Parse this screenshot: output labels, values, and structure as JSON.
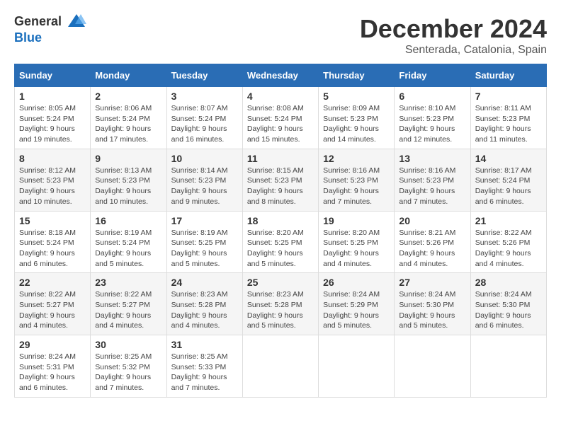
{
  "logo": {
    "general": "General",
    "blue": "Blue"
  },
  "title": "December 2024",
  "subtitle": "Senterada, Catalonia, Spain",
  "days_header": [
    "Sunday",
    "Monday",
    "Tuesday",
    "Wednesday",
    "Thursday",
    "Friday",
    "Saturday"
  ],
  "weeks": [
    [
      {
        "day": "1",
        "sunrise": "8:05 AM",
        "sunset": "5:24 PM",
        "daylight": "9 hours and 19 minutes."
      },
      {
        "day": "2",
        "sunrise": "8:06 AM",
        "sunset": "5:24 PM",
        "daylight": "9 hours and 17 minutes."
      },
      {
        "day": "3",
        "sunrise": "8:07 AM",
        "sunset": "5:24 PM",
        "daylight": "9 hours and 16 minutes."
      },
      {
        "day": "4",
        "sunrise": "8:08 AM",
        "sunset": "5:24 PM",
        "daylight": "9 hours and 15 minutes."
      },
      {
        "day": "5",
        "sunrise": "8:09 AM",
        "sunset": "5:23 PM",
        "daylight": "9 hours and 14 minutes."
      },
      {
        "day": "6",
        "sunrise": "8:10 AM",
        "sunset": "5:23 PM",
        "daylight": "9 hours and 12 minutes."
      },
      {
        "day": "7",
        "sunrise": "8:11 AM",
        "sunset": "5:23 PM",
        "daylight": "9 hours and 11 minutes."
      }
    ],
    [
      {
        "day": "8",
        "sunrise": "8:12 AM",
        "sunset": "5:23 PM",
        "daylight": "9 hours and 10 minutes."
      },
      {
        "day": "9",
        "sunrise": "8:13 AM",
        "sunset": "5:23 PM",
        "daylight": "9 hours and 10 minutes."
      },
      {
        "day": "10",
        "sunrise": "8:14 AM",
        "sunset": "5:23 PM",
        "daylight": "9 hours and 9 minutes."
      },
      {
        "day": "11",
        "sunrise": "8:15 AM",
        "sunset": "5:23 PM",
        "daylight": "9 hours and 8 minutes."
      },
      {
        "day": "12",
        "sunrise": "8:16 AM",
        "sunset": "5:23 PM",
        "daylight": "9 hours and 7 minutes."
      },
      {
        "day": "13",
        "sunrise": "8:16 AM",
        "sunset": "5:23 PM",
        "daylight": "9 hours and 7 minutes."
      },
      {
        "day": "14",
        "sunrise": "8:17 AM",
        "sunset": "5:24 PM",
        "daylight": "9 hours and 6 minutes."
      }
    ],
    [
      {
        "day": "15",
        "sunrise": "8:18 AM",
        "sunset": "5:24 PM",
        "daylight": "9 hours and 6 minutes."
      },
      {
        "day": "16",
        "sunrise": "8:19 AM",
        "sunset": "5:24 PM",
        "daylight": "9 hours and 5 minutes."
      },
      {
        "day": "17",
        "sunrise": "8:19 AM",
        "sunset": "5:25 PM",
        "daylight": "9 hours and 5 minutes."
      },
      {
        "day": "18",
        "sunrise": "8:20 AM",
        "sunset": "5:25 PM",
        "daylight": "9 hours and 5 minutes."
      },
      {
        "day": "19",
        "sunrise": "8:20 AM",
        "sunset": "5:25 PM",
        "daylight": "9 hours and 4 minutes."
      },
      {
        "day": "20",
        "sunrise": "8:21 AM",
        "sunset": "5:26 PM",
        "daylight": "9 hours and 4 minutes."
      },
      {
        "day": "21",
        "sunrise": "8:22 AM",
        "sunset": "5:26 PM",
        "daylight": "9 hours and 4 minutes."
      }
    ],
    [
      {
        "day": "22",
        "sunrise": "8:22 AM",
        "sunset": "5:27 PM",
        "daylight": "9 hours and 4 minutes."
      },
      {
        "day": "23",
        "sunrise": "8:22 AM",
        "sunset": "5:27 PM",
        "daylight": "9 hours and 4 minutes."
      },
      {
        "day": "24",
        "sunrise": "8:23 AM",
        "sunset": "5:28 PM",
        "daylight": "9 hours and 4 minutes."
      },
      {
        "day": "25",
        "sunrise": "8:23 AM",
        "sunset": "5:28 PM",
        "daylight": "9 hours and 5 minutes."
      },
      {
        "day": "26",
        "sunrise": "8:24 AM",
        "sunset": "5:29 PM",
        "daylight": "9 hours and 5 minutes."
      },
      {
        "day": "27",
        "sunrise": "8:24 AM",
        "sunset": "5:30 PM",
        "daylight": "9 hours and 5 minutes."
      },
      {
        "day": "28",
        "sunrise": "8:24 AM",
        "sunset": "5:30 PM",
        "daylight": "9 hours and 6 minutes."
      }
    ],
    [
      {
        "day": "29",
        "sunrise": "8:24 AM",
        "sunset": "5:31 PM",
        "daylight": "9 hours and 6 minutes."
      },
      {
        "day": "30",
        "sunrise": "8:25 AM",
        "sunset": "5:32 PM",
        "daylight": "9 hours and 7 minutes."
      },
      {
        "day": "31",
        "sunrise": "8:25 AM",
        "sunset": "5:33 PM",
        "daylight": "9 hours and 7 minutes."
      },
      null,
      null,
      null,
      null
    ]
  ],
  "labels": {
    "sunrise": "Sunrise:",
    "sunset": "Sunset:",
    "daylight": "Daylight:"
  }
}
